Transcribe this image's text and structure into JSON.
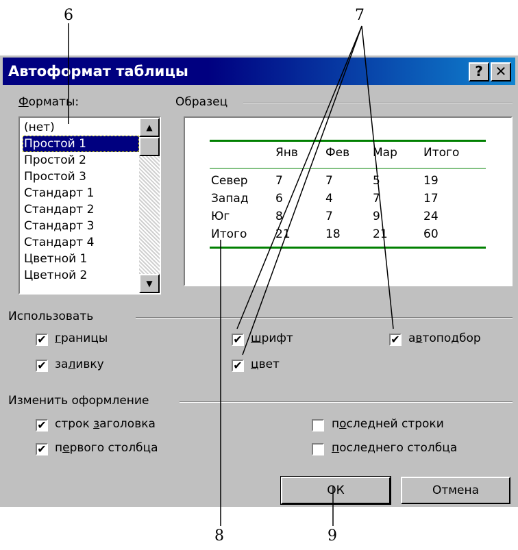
{
  "callouts": [
    "6",
    "7",
    "8",
    "9"
  ],
  "dialog": {
    "title": "Автоформат таблицы",
    "help_glyph": "?",
    "close_glyph": "✕"
  },
  "formats": {
    "label_prefix": "Ф",
    "label_rest": "орматы:",
    "items": [
      "(нет)",
      "Простой 1",
      "Простой 2",
      "Простой 3",
      "Стандарт 1",
      "Стандарт 2",
      "Стандарт 3",
      "Стандарт 4",
      "Цветной 1",
      "Цветной 2"
    ],
    "selected": "Простой 1"
  },
  "sample": {
    "label": "Образец",
    "header": [
      "",
      "Янв",
      "Фев",
      "Мар",
      "Итого"
    ],
    "rows": [
      [
        "Север",
        "7",
        "7",
        "5",
        "19"
      ],
      [
        "Запад",
        "6",
        "4",
        "7",
        "17"
      ],
      [
        "Юг",
        "8",
        "7",
        "9",
        "24"
      ],
      [
        "Итого",
        "21",
        "18",
        "21",
        "60"
      ]
    ],
    "line_color": "#008000"
  },
  "use": {
    "label": "Использовать",
    "borders": {
      "ul": "г",
      "rest": "раницы",
      "checked": true
    },
    "fill": {
      "pre": "за",
      "ul": "л",
      "rest": "ивку",
      "checked": true
    },
    "font": {
      "ul": "ш",
      "rest": "рифт",
      "checked": true
    },
    "color": {
      "ul": "ц",
      "rest": "вет",
      "checked": true
    },
    "autofit": {
      "pre": "а",
      "ul": "в",
      "rest": "топодбор",
      "checked": true
    }
  },
  "apply": {
    "label": "Изменить оформление",
    "header_rows": {
      "pre": "строк ",
      "ul": "з",
      "rest": "аголовка",
      "checked": true
    },
    "first_column": {
      "pre": "п",
      "ul": "е",
      "rest": "рвого столбца",
      "checked": true
    },
    "last_row": {
      "pre": "п",
      "ul": "о",
      "rest": "следней строки",
      "checked": false
    },
    "last_column": {
      "ul": "п",
      "rest": "оследнего столбца",
      "checked": false
    }
  },
  "buttons": {
    "ok": "ОК",
    "cancel": "Отмена"
  },
  "check_glyph": "✔",
  "arrow_up": "▲",
  "arrow_down": "▼"
}
